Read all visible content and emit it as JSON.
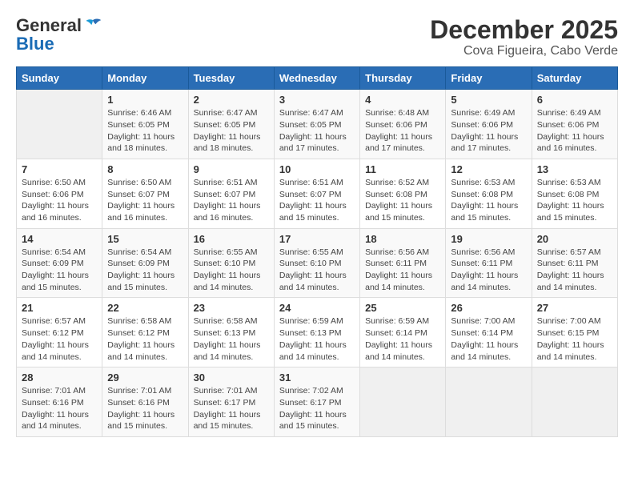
{
  "logo": {
    "general": "General",
    "blue": "Blue"
  },
  "title": "December 2025",
  "subtitle": "Cova Figueira, Cabo Verde",
  "weekdays": [
    "Sunday",
    "Monday",
    "Tuesday",
    "Wednesday",
    "Thursday",
    "Friday",
    "Saturday"
  ],
  "weeks": [
    [
      {
        "day": "",
        "sunrise": "",
        "sunset": "",
        "daylight": "",
        "empty": true
      },
      {
        "day": "1",
        "sunrise": "Sunrise: 6:46 AM",
        "sunset": "Sunset: 6:05 PM",
        "daylight": "Daylight: 11 hours and 18 minutes."
      },
      {
        "day": "2",
        "sunrise": "Sunrise: 6:47 AM",
        "sunset": "Sunset: 6:05 PM",
        "daylight": "Daylight: 11 hours and 18 minutes."
      },
      {
        "day": "3",
        "sunrise": "Sunrise: 6:47 AM",
        "sunset": "Sunset: 6:05 PM",
        "daylight": "Daylight: 11 hours and 17 minutes."
      },
      {
        "day": "4",
        "sunrise": "Sunrise: 6:48 AM",
        "sunset": "Sunset: 6:06 PM",
        "daylight": "Daylight: 11 hours and 17 minutes."
      },
      {
        "day": "5",
        "sunrise": "Sunrise: 6:49 AM",
        "sunset": "Sunset: 6:06 PM",
        "daylight": "Daylight: 11 hours and 17 minutes."
      },
      {
        "day": "6",
        "sunrise": "Sunrise: 6:49 AM",
        "sunset": "Sunset: 6:06 PM",
        "daylight": "Daylight: 11 hours and 16 minutes."
      }
    ],
    [
      {
        "day": "7",
        "sunrise": "Sunrise: 6:50 AM",
        "sunset": "Sunset: 6:06 PM",
        "daylight": "Daylight: 11 hours and 16 minutes."
      },
      {
        "day": "8",
        "sunrise": "Sunrise: 6:50 AM",
        "sunset": "Sunset: 6:07 PM",
        "daylight": "Daylight: 11 hours and 16 minutes."
      },
      {
        "day": "9",
        "sunrise": "Sunrise: 6:51 AM",
        "sunset": "Sunset: 6:07 PM",
        "daylight": "Daylight: 11 hours and 16 minutes."
      },
      {
        "day": "10",
        "sunrise": "Sunrise: 6:51 AM",
        "sunset": "Sunset: 6:07 PM",
        "daylight": "Daylight: 11 hours and 15 minutes."
      },
      {
        "day": "11",
        "sunrise": "Sunrise: 6:52 AM",
        "sunset": "Sunset: 6:08 PM",
        "daylight": "Daylight: 11 hours and 15 minutes."
      },
      {
        "day": "12",
        "sunrise": "Sunrise: 6:53 AM",
        "sunset": "Sunset: 6:08 PM",
        "daylight": "Daylight: 11 hours and 15 minutes."
      },
      {
        "day": "13",
        "sunrise": "Sunrise: 6:53 AM",
        "sunset": "Sunset: 6:08 PM",
        "daylight": "Daylight: 11 hours and 15 minutes."
      }
    ],
    [
      {
        "day": "14",
        "sunrise": "Sunrise: 6:54 AM",
        "sunset": "Sunset: 6:09 PM",
        "daylight": "Daylight: 11 hours and 15 minutes."
      },
      {
        "day": "15",
        "sunrise": "Sunrise: 6:54 AM",
        "sunset": "Sunset: 6:09 PM",
        "daylight": "Daylight: 11 hours and 15 minutes."
      },
      {
        "day": "16",
        "sunrise": "Sunrise: 6:55 AM",
        "sunset": "Sunset: 6:10 PM",
        "daylight": "Daylight: 11 hours and 14 minutes."
      },
      {
        "day": "17",
        "sunrise": "Sunrise: 6:55 AM",
        "sunset": "Sunset: 6:10 PM",
        "daylight": "Daylight: 11 hours and 14 minutes."
      },
      {
        "day": "18",
        "sunrise": "Sunrise: 6:56 AM",
        "sunset": "Sunset: 6:11 PM",
        "daylight": "Daylight: 11 hours and 14 minutes."
      },
      {
        "day": "19",
        "sunrise": "Sunrise: 6:56 AM",
        "sunset": "Sunset: 6:11 PM",
        "daylight": "Daylight: 11 hours and 14 minutes."
      },
      {
        "day": "20",
        "sunrise": "Sunrise: 6:57 AM",
        "sunset": "Sunset: 6:11 PM",
        "daylight": "Daylight: 11 hours and 14 minutes."
      }
    ],
    [
      {
        "day": "21",
        "sunrise": "Sunrise: 6:57 AM",
        "sunset": "Sunset: 6:12 PM",
        "daylight": "Daylight: 11 hours and 14 minutes."
      },
      {
        "day": "22",
        "sunrise": "Sunrise: 6:58 AM",
        "sunset": "Sunset: 6:12 PM",
        "daylight": "Daylight: 11 hours and 14 minutes."
      },
      {
        "day": "23",
        "sunrise": "Sunrise: 6:58 AM",
        "sunset": "Sunset: 6:13 PM",
        "daylight": "Daylight: 11 hours and 14 minutes."
      },
      {
        "day": "24",
        "sunrise": "Sunrise: 6:59 AM",
        "sunset": "Sunset: 6:13 PM",
        "daylight": "Daylight: 11 hours and 14 minutes."
      },
      {
        "day": "25",
        "sunrise": "Sunrise: 6:59 AM",
        "sunset": "Sunset: 6:14 PM",
        "daylight": "Daylight: 11 hours and 14 minutes."
      },
      {
        "day": "26",
        "sunrise": "Sunrise: 7:00 AM",
        "sunset": "Sunset: 6:14 PM",
        "daylight": "Daylight: 11 hours and 14 minutes."
      },
      {
        "day": "27",
        "sunrise": "Sunrise: 7:00 AM",
        "sunset": "Sunset: 6:15 PM",
        "daylight": "Daylight: 11 hours and 14 minutes."
      }
    ],
    [
      {
        "day": "28",
        "sunrise": "Sunrise: 7:01 AM",
        "sunset": "Sunset: 6:16 PM",
        "daylight": "Daylight: 11 hours and 14 minutes."
      },
      {
        "day": "29",
        "sunrise": "Sunrise: 7:01 AM",
        "sunset": "Sunset: 6:16 PM",
        "daylight": "Daylight: 11 hours and 15 minutes."
      },
      {
        "day": "30",
        "sunrise": "Sunrise: 7:01 AM",
        "sunset": "Sunset: 6:17 PM",
        "daylight": "Daylight: 11 hours and 15 minutes."
      },
      {
        "day": "31",
        "sunrise": "Sunrise: 7:02 AM",
        "sunset": "Sunset: 6:17 PM",
        "daylight": "Daylight: 11 hours and 15 minutes."
      },
      {
        "day": "",
        "sunrise": "",
        "sunset": "",
        "daylight": "",
        "empty": true
      },
      {
        "day": "",
        "sunrise": "",
        "sunset": "",
        "daylight": "",
        "empty": true
      },
      {
        "day": "",
        "sunrise": "",
        "sunset": "",
        "daylight": "",
        "empty": true
      }
    ]
  ]
}
